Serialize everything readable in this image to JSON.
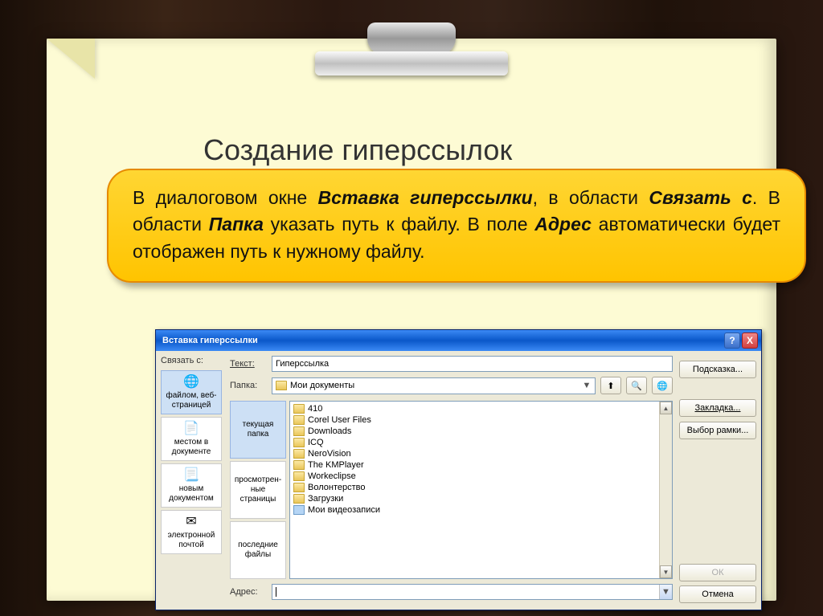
{
  "slide": {
    "title": "Создание гиперссылок",
    "callout_parts": {
      "p1": "В диалоговом окне ",
      "b1": "Вставка гиперссылки",
      "p2": ", в области ",
      "b2": "Связать с",
      "p3": ". В области ",
      "b3": "Папка",
      "p4": " указать путь к файлу. В поле ",
      "b4": "Адрес",
      "p5": " автоматически будет отображен путь к нужному файлу."
    }
  },
  "dialog": {
    "title": "Вставка гиперссылки",
    "link_with_label": "Связать с:",
    "text_label": "Текст:",
    "text_value": "Гиперссылка",
    "folder_label": "Папка:",
    "folder_value": "Мои документы",
    "address_label": "Адрес:",
    "address_value": "",
    "link_types": [
      {
        "label": "файлом, веб-страницей",
        "icon": "🌐"
      },
      {
        "label": "местом в документе",
        "icon": "📄"
      },
      {
        "label": "новым документом",
        "icon": "📃"
      },
      {
        "label": "электронной почтой",
        "icon": "✉"
      }
    ],
    "browse_tabs": [
      "текущая папка",
      "просмотрен-ные страницы",
      "последние файлы"
    ],
    "files": [
      {
        "name": "410",
        "type": "folder"
      },
      {
        "name": "Corel User Files",
        "type": "folder"
      },
      {
        "name": "Downloads",
        "type": "folder"
      },
      {
        "name": "ICQ",
        "type": "folder"
      },
      {
        "name": "NeroVision",
        "type": "folder"
      },
      {
        "name": "The KMPlayer",
        "type": "folder"
      },
      {
        "name": "Workeclipse",
        "type": "folder"
      },
      {
        "name": "Волонтерство",
        "type": "folder"
      },
      {
        "name": "Загрузки",
        "type": "folder"
      },
      {
        "name": "Мои видеозаписи",
        "type": "file"
      }
    ],
    "buttons": {
      "screentip": "Подсказка...",
      "bookmark": "Закладка...",
      "target_frame": "Выбор рамки...",
      "ok": "ОК",
      "cancel": "Отмена"
    },
    "titlebar_icons": {
      "help": "?",
      "close": "X"
    },
    "nav_icons": {
      "up": "⬆",
      "browse": "🔍",
      "web": "🌐"
    }
  }
}
